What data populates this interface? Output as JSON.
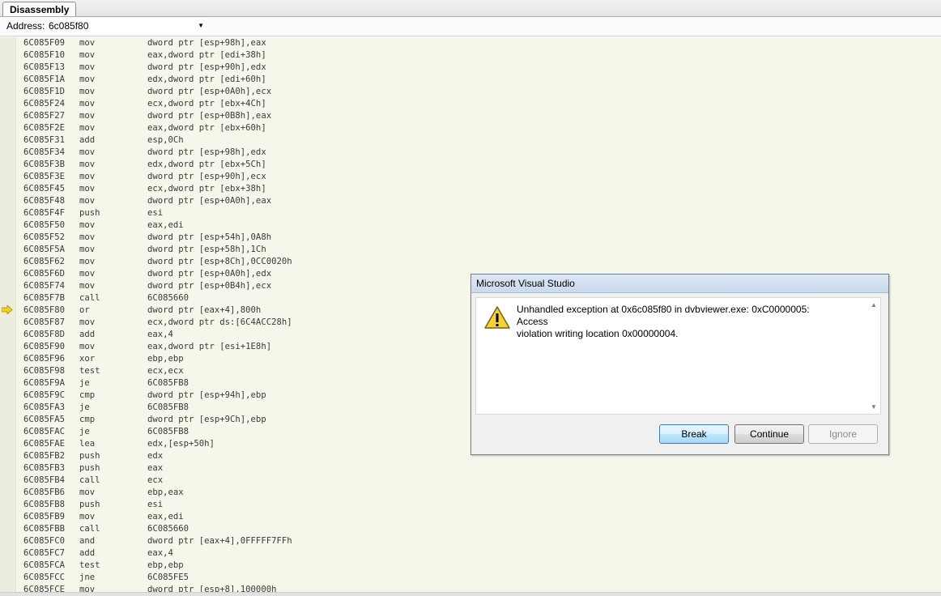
{
  "window": {
    "tab_label": "Disassembly"
  },
  "address_bar": {
    "label": "Address:",
    "value": "6c085f80"
  },
  "disassembly": {
    "current_instruction_address": "6C085F80",
    "lines": [
      {
        "addr": "6C085F09",
        "mnemonic": "mov",
        "operands": "dword ptr [esp+98h],eax"
      },
      {
        "addr": "6C085F10",
        "mnemonic": "mov",
        "operands": "eax,dword ptr [edi+38h]"
      },
      {
        "addr": "6C085F13",
        "mnemonic": "mov",
        "operands": "dword ptr [esp+90h],edx"
      },
      {
        "addr": "6C085F1A",
        "mnemonic": "mov",
        "operands": "edx,dword ptr [edi+60h]"
      },
      {
        "addr": "6C085F1D",
        "mnemonic": "mov",
        "operands": "dword ptr [esp+0A0h],ecx"
      },
      {
        "addr": "6C085F24",
        "mnemonic": "mov",
        "operands": "ecx,dword ptr [ebx+4Ch]"
      },
      {
        "addr": "6C085F27",
        "mnemonic": "mov",
        "operands": "dword ptr [esp+0B8h],eax"
      },
      {
        "addr": "6C085F2E",
        "mnemonic": "mov",
        "operands": "eax,dword ptr [ebx+60h]"
      },
      {
        "addr": "6C085F31",
        "mnemonic": "add",
        "operands": "esp,0Ch"
      },
      {
        "addr": "6C085F34",
        "mnemonic": "mov",
        "operands": "dword ptr [esp+98h],edx"
      },
      {
        "addr": "6C085F3B",
        "mnemonic": "mov",
        "operands": "edx,dword ptr [ebx+5Ch]"
      },
      {
        "addr": "6C085F3E",
        "mnemonic": "mov",
        "operands": "dword ptr [esp+90h],ecx"
      },
      {
        "addr": "6C085F45",
        "mnemonic": "mov",
        "operands": "ecx,dword ptr [ebx+38h]"
      },
      {
        "addr": "6C085F48",
        "mnemonic": "mov",
        "operands": "dword ptr [esp+0A0h],eax"
      },
      {
        "addr": "6C085F4F",
        "mnemonic": "push",
        "operands": "esi"
      },
      {
        "addr": "6C085F50",
        "mnemonic": "mov",
        "operands": "eax,edi"
      },
      {
        "addr": "6C085F52",
        "mnemonic": "mov",
        "operands": "dword ptr [esp+54h],0A8h"
      },
      {
        "addr": "6C085F5A",
        "mnemonic": "mov",
        "operands": "dword ptr [esp+58h],1Ch"
      },
      {
        "addr": "6C085F62",
        "mnemonic": "mov",
        "operands": "dword ptr [esp+8Ch],0CC0020h"
      },
      {
        "addr": "6C085F6D",
        "mnemonic": "mov",
        "operands": "dword ptr [esp+0A0h],edx"
      },
      {
        "addr": "6C085F74",
        "mnemonic": "mov",
        "operands": "dword ptr [esp+0B4h],ecx"
      },
      {
        "addr": "6C085F7B",
        "mnemonic": "call",
        "operands": "6C085660"
      },
      {
        "addr": "6C085F80",
        "mnemonic": "or",
        "operands": "dword ptr [eax+4],800h"
      },
      {
        "addr": "6C085F87",
        "mnemonic": "mov",
        "operands": "ecx,dword ptr ds:[6C4ACC28h]"
      },
      {
        "addr": "6C085F8D",
        "mnemonic": "add",
        "operands": "eax,4"
      },
      {
        "addr": "6C085F90",
        "mnemonic": "mov",
        "operands": "eax,dword ptr [esi+1E8h]"
      },
      {
        "addr": "6C085F96",
        "mnemonic": "xor",
        "operands": "ebp,ebp"
      },
      {
        "addr": "6C085F98",
        "mnemonic": "test",
        "operands": "ecx,ecx"
      },
      {
        "addr": "6C085F9A",
        "mnemonic": "je",
        "operands": "6C085FB8"
      },
      {
        "addr": "6C085F9C",
        "mnemonic": "cmp",
        "operands": "dword ptr [esp+94h],ebp"
      },
      {
        "addr": "6C085FA3",
        "mnemonic": "je",
        "operands": "6C085FB8"
      },
      {
        "addr": "6C085FA5",
        "mnemonic": "cmp",
        "operands": "dword ptr [esp+9Ch],ebp"
      },
      {
        "addr": "6C085FAC",
        "mnemonic": "je",
        "operands": "6C085FB8"
      },
      {
        "addr": "6C085FAE",
        "mnemonic": "lea",
        "operands": "edx,[esp+50h]"
      },
      {
        "addr": "6C085FB2",
        "mnemonic": "push",
        "operands": "edx"
      },
      {
        "addr": "6C085FB3",
        "mnemonic": "push",
        "operands": "eax"
      },
      {
        "addr": "6C085FB4",
        "mnemonic": "call",
        "operands": "ecx"
      },
      {
        "addr": "6C085FB6",
        "mnemonic": "mov",
        "operands": "ebp,eax"
      },
      {
        "addr": "6C085FB8",
        "mnemonic": "push",
        "operands": "esi"
      },
      {
        "addr": "6C085FB9",
        "mnemonic": "mov",
        "operands": "eax,edi"
      },
      {
        "addr": "6C085FBB",
        "mnemonic": "call",
        "operands": "6C085660"
      },
      {
        "addr": "6C085FC0",
        "mnemonic": "and",
        "operands": "dword ptr [eax+4],0FFFFF7FFh"
      },
      {
        "addr": "6C085FC7",
        "mnemonic": "add",
        "operands": "eax,4"
      },
      {
        "addr": "6C085FCA",
        "mnemonic": "test",
        "operands": "ebp,ebp"
      },
      {
        "addr": "6C085FCC",
        "mnemonic": "jne",
        "operands": "6C085FE5"
      },
      {
        "addr": "6C085FCE",
        "mnemonic": "mov",
        "operands": "dword ptr [esp+8],100000h"
      }
    ]
  },
  "dialog": {
    "title": "Microsoft Visual Studio",
    "message_line1": "Unhandled exception at 0x6c085f80 in dvbviewer.exe: 0xC0000005: Access",
    "message_line2": "violation writing location 0x00000004.",
    "icon": "warning-icon",
    "buttons": {
      "break": "Break",
      "continue": "Continue",
      "ignore": "Ignore"
    }
  },
  "colors": {
    "editor_background": "#f6f6ea",
    "instruction_pointer": "#f2d21b"
  }
}
